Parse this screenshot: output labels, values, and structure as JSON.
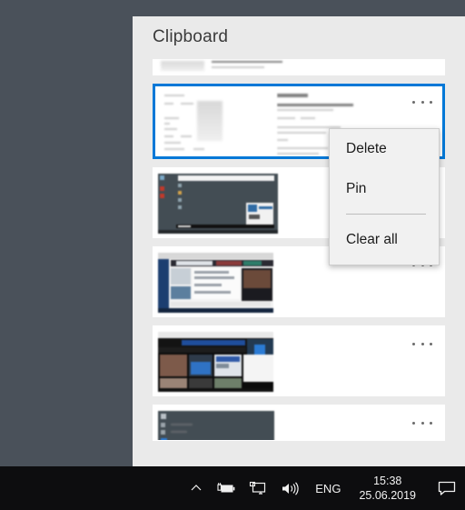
{
  "desktop": {
    "background_color": "#4a515a"
  },
  "clipboard": {
    "title": "Clipboard",
    "panel_background": "#eaeaea",
    "accent_color": "#0078d7",
    "items": [
      {
        "id": "item-0",
        "kind": "text-snippet-partial",
        "selected": false,
        "more_label": "•••"
      },
      {
        "id": "item-1",
        "kind": "document-screenshot",
        "selected": true,
        "more_label": "•••"
      },
      {
        "id": "item-2",
        "kind": "dark-app-screenshot",
        "selected": false,
        "more_label": "•••"
      },
      {
        "id": "item-3",
        "kind": "browser-screenshot",
        "selected": false,
        "more_label": "•••"
      },
      {
        "id": "item-4",
        "kind": "video-gallery-screenshot",
        "selected": false,
        "more_label": "•••"
      },
      {
        "id": "item-5",
        "kind": "dark-desktop-screenshot-partial",
        "selected": false,
        "more_label": "•••"
      }
    ]
  },
  "context_menu": {
    "items": [
      {
        "label": "Delete",
        "type": "item"
      },
      {
        "label": "Pin",
        "type": "item"
      },
      {
        "label": "",
        "type": "separator"
      },
      {
        "label": "Clear all",
        "type": "item"
      }
    ]
  },
  "taskbar": {
    "background_color": "#0d0d0f",
    "show_hidden_icons": "show-hidden-icons-chevron",
    "battery_icon": "battery-charging-icon",
    "display_icon": "display-projection-icon",
    "volume_icon": "volume-speaker-icon",
    "language": "ENG",
    "time": "15:38",
    "date": "25.06.2019",
    "action_center_icon": "action-center-icon"
  }
}
